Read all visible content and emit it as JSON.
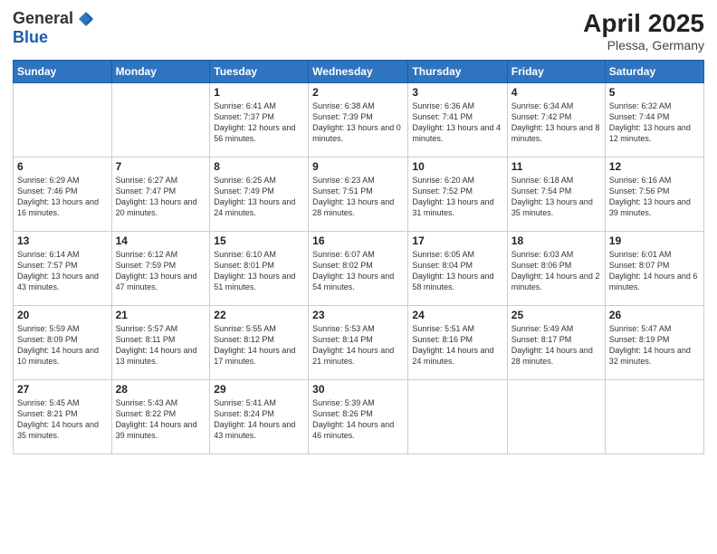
{
  "header": {
    "logo_general": "General",
    "logo_blue": "Blue",
    "title": "April 2025",
    "location": "Plessa, Germany"
  },
  "weekdays": [
    "Sunday",
    "Monday",
    "Tuesday",
    "Wednesday",
    "Thursday",
    "Friday",
    "Saturday"
  ],
  "weeks": [
    [
      {
        "day": "",
        "info": ""
      },
      {
        "day": "",
        "info": ""
      },
      {
        "day": "1",
        "info": "Sunrise: 6:41 AM\nSunset: 7:37 PM\nDaylight: 12 hours and 56 minutes."
      },
      {
        "day": "2",
        "info": "Sunrise: 6:38 AM\nSunset: 7:39 PM\nDaylight: 13 hours and 0 minutes."
      },
      {
        "day": "3",
        "info": "Sunrise: 6:36 AM\nSunset: 7:41 PM\nDaylight: 13 hours and 4 minutes."
      },
      {
        "day": "4",
        "info": "Sunrise: 6:34 AM\nSunset: 7:42 PM\nDaylight: 13 hours and 8 minutes."
      },
      {
        "day": "5",
        "info": "Sunrise: 6:32 AM\nSunset: 7:44 PM\nDaylight: 13 hours and 12 minutes."
      }
    ],
    [
      {
        "day": "6",
        "info": "Sunrise: 6:29 AM\nSunset: 7:46 PM\nDaylight: 13 hours and 16 minutes."
      },
      {
        "day": "7",
        "info": "Sunrise: 6:27 AM\nSunset: 7:47 PM\nDaylight: 13 hours and 20 minutes."
      },
      {
        "day": "8",
        "info": "Sunrise: 6:25 AM\nSunset: 7:49 PM\nDaylight: 13 hours and 24 minutes."
      },
      {
        "day": "9",
        "info": "Sunrise: 6:23 AM\nSunset: 7:51 PM\nDaylight: 13 hours and 28 minutes."
      },
      {
        "day": "10",
        "info": "Sunrise: 6:20 AM\nSunset: 7:52 PM\nDaylight: 13 hours and 31 minutes."
      },
      {
        "day": "11",
        "info": "Sunrise: 6:18 AM\nSunset: 7:54 PM\nDaylight: 13 hours and 35 minutes."
      },
      {
        "day": "12",
        "info": "Sunrise: 6:16 AM\nSunset: 7:56 PM\nDaylight: 13 hours and 39 minutes."
      }
    ],
    [
      {
        "day": "13",
        "info": "Sunrise: 6:14 AM\nSunset: 7:57 PM\nDaylight: 13 hours and 43 minutes."
      },
      {
        "day": "14",
        "info": "Sunrise: 6:12 AM\nSunset: 7:59 PM\nDaylight: 13 hours and 47 minutes."
      },
      {
        "day": "15",
        "info": "Sunrise: 6:10 AM\nSunset: 8:01 PM\nDaylight: 13 hours and 51 minutes."
      },
      {
        "day": "16",
        "info": "Sunrise: 6:07 AM\nSunset: 8:02 PM\nDaylight: 13 hours and 54 minutes."
      },
      {
        "day": "17",
        "info": "Sunrise: 6:05 AM\nSunset: 8:04 PM\nDaylight: 13 hours and 58 minutes."
      },
      {
        "day": "18",
        "info": "Sunrise: 6:03 AM\nSunset: 8:06 PM\nDaylight: 14 hours and 2 minutes."
      },
      {
        "day": "19",
        "info": "Sunrise: 6:01 AM\nSunset: 8:07 PM\nDaylight: 14 hours and 6 minutes."
      }
    ],
    [
      {
        "day": "20",
        "info": "Sunrise: 5:59 AM\nSunset: 8:09 PM\nDaylight: 14 hours and 10 minutes."
      },
      {
        "day": "21",
        "info": "Sunrise: 5:57 AM\nSunset: 8:11 PM\nDaylight: 14 hours and 13 minutes."
      },
      {
        "day": "22",
        "info": "Sunrise: 5:55 AM\nSunset: 8:12 PM\nDaylight: 14 hours and 17 minutes."
      },
      {
        "day": "23",
        "info": "Sunrise: 5:53 AM\nSunset: 8:14 PM\nDaylight: 14 hours and 21 minutes."
      },
      {
        "day": "24",
        "info": "Sunrise: 5:51 AM\nSunset: 8:16 PM\nDaylight: 14 hours and 24 minutes."
      },
      {
        "day": "25",
        "info": "Sunrise: 5:49 AM\nSunset: 8:17 PM\nDaylight: 14 hours and 28 minutes."
      },
      {
        "day": "26",
        "info": "Sunrise: 5:47 AM\nSunset: 8:19 PM\nDaylight: 14 hours and 32 minutes."
      }
    ],
    [
      {
        "day": "27",
        "info": "Sunrise: 5:45 AM\nSunset: 8:21 PM\nDaylight: 14 hours and 35 minutes."
      },
      {
        "day": "28",
        "info": "Sunrise: 5:43 AM\nSunset: 8:22 PM\nDaylight: 14 hours and 39 minutes."
      },
      {
        "day": "29",
        "info": "Sunrise: 5:41 AM\nSunset: 8:24 PM\nDaylight: 14 hours and 43 minutes."
      },
      {
        "day": "30",
        "info": "Sunrise: 5:39 AM\nSunset: 8:26 PM\nDaylight: 14 hours and 46 minutes."
      },
      {
        "day": "",
        "info": ""
      },
      {
        "day": "",
        "info": ""
      },
      {
        "day": "",
        "info": ""
      }
    ]
  ]
}
